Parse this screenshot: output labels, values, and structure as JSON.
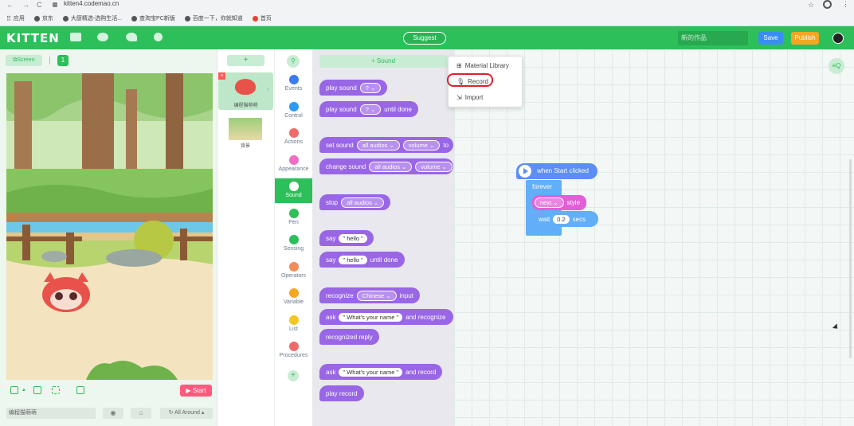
{
  "browser": {
    "url": "kitten4.codemao.cn",
    "nav": [
      "←",
      "→",
      "C"
    ],
    "bookmarks": [
      "应用",
      "京东",
      "大厨精选-选购生活...",
      "查淘宝PC新版",
      "百度一下，你就知道",
      "首页"
    ]
  },
  "header": {
    "logo": "KITTEN",
    "suggest": "Suggest",
    "work_name": "新的作品",
    "save": "Save",
    "publish": "Publish"
  },
  "stage": {
    "screen_label": "Screen",
    "screen_number": "1",
    "start": "Start",
    "sprite_name": "编程猫萌萌",
    "all_around": "All Around"
  },
  "sprites": {
    "add": "+",
    "items": [
      {
        "label": "编程猫萌萌"
      },
      {
        "label": "背景"
      }
    ]
  },
  "categories": [
    {
      "label": "Events",
      "color": "#3a7bf0"
    },
    {
      "label": "Control",
      "color": "#2f9af2"
    },
    {
      "label": "Actions",
      "color": "#f06a6a"
    },
    {
      "label": "Appearance",
      "color": "#f06fc4"
    },
    {
      "label": "Sound",
      "color": "#a46cf0",
      "selected": true
    },
    {
      "label": "Pen",
      "color": "#2dbf5a"
    },
    {
      "label": "Sensing",
      "color": "#2dbf5a"
    },
    {
      "label": "Operators",
      "color": "#f08c5a"
    },
    {
      "label": "Variable",
      "color": "#f5a623"
    },
    {
      "label": "List",
      "color": "#f5c623"
    },
    {
      "label": "Procedures",
      "color": "#f06a6a"
    }
  ],
  "palette": {
    "add_sound": "+ Sound",
    "blocks": {
      "play_sound": "play sound",
      "play_sound_until": "play sound",
      "until_done": "until done",
      "q": "?",
      "set_sound": "set sound",
      "change_sound": "change sound",
      "all_audios": "all audios",
      "volume": "volume",
      "to": "to",
      "stop": "stop",
      "say": "say",
      "hello": "\" hello \"",
      "say_until": "say",
      "hello2": "\" hello \"",
      "until_done2": "until done",
      "recognize": "recognize",
      "chinese": "Chinese",
      "input": "input",
      "ask": "ask",
      "whats_name": "\" What's your name \"",
      "and_recognize": "and recognize",
      "recognized_reply": "recognized reply",
      "ask2": "ask",
      "whats_name2": "\" What's your name \"",
      "and_record": "and record",
      "play_record": "play record"
    }
  },
  "dropdown": {
    "items": [
      "Material Library",
      "Record",
      "Import"
    ]
  },
  "script": {
    "hat": "when Start clicked",
    "forever": "forever",
    "next": "next",
    "style": "style",
    "wait": "wait",
    "wait_value": "0.2",
    "secs": "secs"
  }
}
